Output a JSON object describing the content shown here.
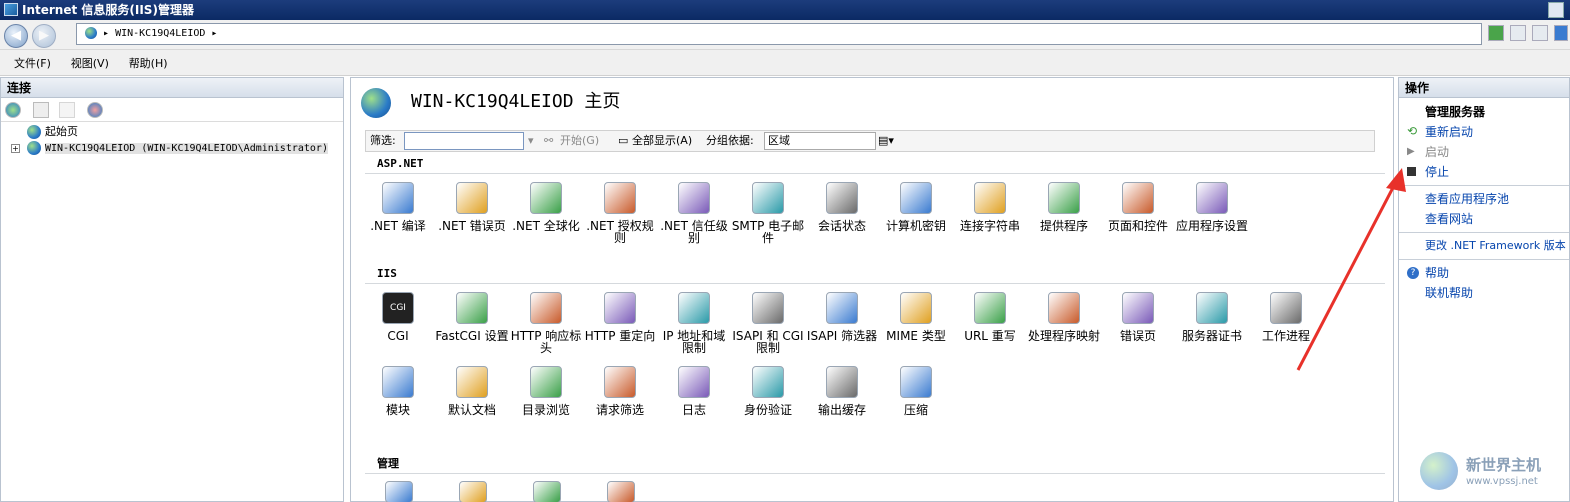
{
  "window": {
    "title": "Internet 信息服务(IIS)管理器"
  },
  "address_bar": {
    "path_segment": "WIN-KC19Q4LEIOD",
    "back_icon": "back-arrow-icon",
    "forward_icon": "forward-arrow-icon"
  },
  "menu": {
    "file": "文件(F)",
    "view": "视图(V)",
    "help": "帮助(H)"
  },
  "connections": {
    "header": "连接",
    "tree": {
      "start_page": "起始页",
      "server": "WIN-KC19Q4LEIOD (WIN-KC19Q4LEIOD\\Administrator)",
      "server_expander": "+"
    }
  },
  "center": {
    "title": "WIN-KC19Q4LEIOD 主页",
    "filter": {
      "label": "筛选:",
      "value": "",
      "start": "开始(G)",
      "show_all": "全部显示(A)",
      "group_by_label": "分组依据:",
      "group_by_value": "区域"
    },
    "sections": [
      {
        "title": "ASP.NET",
        "items": [
          {
            "label": ".NET 编译",
            "icon": "dotnet-compile-icon"
          },
          {
            "label": ".NET 错误页",
            "icon": "dotnet-error-pages-icon"
          },
          {
            "label": ".NET 全球化",
            "icon": "dotnet-globalization-icon"
          },
          {
            "label": ".NET 授权规则",
            "icon": "dotnet-authorization-icon"
          },
          {
            "label": ".NET 信任级别",
            "icon": "dotnet-trust-icon"
          },
          {
            "label": "SMTP 电子邮件",
            "icon": "smtp-email-icon"
          },
          {
            "label": "会话状态",
            "icon": "session-state-icon"
          },
          {
            "label": "计算机密钥",
            "icon": "machine-key-icon"
          },
          {
            "label": "连接字符串",
            "icon": "connection-strings-icon"
          },
          {
            "label": "提供程序",
            "icon": "providers-icon"
          },
          {
            "label": "页面和控件",
            "icon": "pages-controls-icon"
          },
          {
            "label": "应用程序设置",
            "icon": "app-settings-icon"
          }
        ]
      },
      {
        "title": "IIS",
        "items": [
          {
            "label": "CGI",
            "icon": "cgi-icon"
          },
          {
            "label": "FastCGI 设置",
            "icon": "fastcgi-icon"
          },
          {
            "label": "HTTP 响应标头",
            "icon": "http-headers-icon"
          },
          {
            "label": "HTTP 重定向",
            "icon": "http-redirect-icon"
          },
          {
            "label": "IP 地址和域限制",
            "icon": "ip-restrictions-icon"
          },
          {
            "label": "ISAPI 和 CGI 限制",
            "icon": "isapi-cgi-icon"
          },
          {
            "label": "ISAPI 筛选器",
            "icon": "isapi-filters-icon"
          },
          {
            "label": "MIME 类型",
            "icon": "mime-types-icon"
          },
          {
            "label": "URL 重写",
            "icon": "url-rewrite-icon"
          },
          {
            "label": "处理程序映射",
            "icon": "handler-mappings-icon"
          },
          {
            "label": "错误页",
            "icon": "error-pages-icon"
          },
          {
            "label": "服务器证书",
            "icon": "server-certificates-icon"
          },
          {
            "label": "工作进程",
            "icon": "worker-processes-icon"
          },
          {
            "label": "模块",
            "icon": "modules-icon"
          },
          {
            "label": "默认文档",
            "icon": "default-document-icon"
          },
          {
            "label": "目录浏览",
            "icon": "directory-browsing-icon"
          },
          {
            "label": "请求筛选",
            "icon": "request-filtering-icon"
          },
          {
            "label": "日志",
            "icon": "logging-icon"
          },
          {
            "label": "身份验证",
            "icon": "authentication-icon"
          },
          {
            "label": "输出缓存",
            "icon": "output-caching-icon"
          },
          {
            "label": "压缩",
            "icon": "compression-icon"
          }
        ]
      },
      {
        "title": "管理",
        "items": []
      }
    ]
  },
  "actions": {
    "header": "操作",
    "manage_server": "管理服务器",
    "restart": "重新启动",
    "start": "启动",
    "stop": "停止",
    "view_app_pools": "查看应用程序池",
    "view_sites": "查看网站",
    "change_framework": "更改 .NET Framework 版本",
    "help": "帮助",
    "online_help": "联机帮助"
  },
  "watermark": {
    "name": "新世界主机",
    "url": "www.vpssj.net"
  },
  "colors": {
    "titlebar": "#0b2a64",
    "link": "#0645ad",
    "annotation_arrow": "#e8312a"
  }
}
